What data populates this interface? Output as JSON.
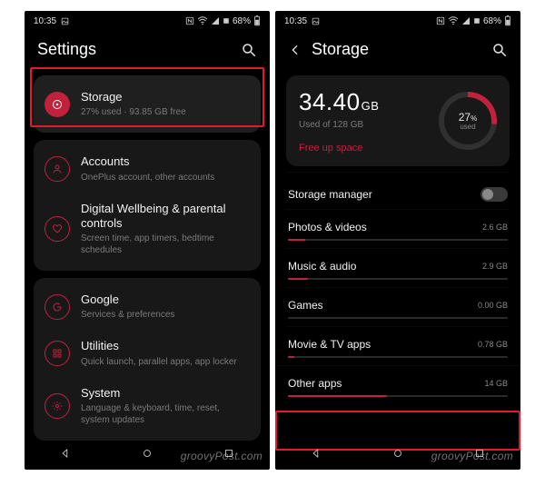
{
  "status": {
    "time": "10:35",
    "battery": "68%"
  },
  "left": {
    "title": "Settings",
    "items": [
      {
        "icon": "disc",
        "title": "Storage",
        "sub": "27% used · 93.85 GB free"
      },
      {
        "icon": "user",
        "title": "Accounts",
        "sub": "OnePlus account, other accounts"
      },
      {
        "icon": "heart",
        "title": "Digital Wellbeing & parental controls",
        "sub": "Screen time, app timers, bedtime schedules"
      },
      {
        "icon": "google",
        "title": "Google",
        "sub": "Services & preferences"
      },
      {
        "icon": "grid",
        "title": "Utilities",
        "sub": "Quick launch, parallel apps, app locker"
      },
      {
        "icon": "gear",
        "title": "System",
        "sub": "Language & keyboard, time, reset, system updates"
      }
    ]
  },
  "right": {
    "title": "Storage",
    "hero": {
      "value": "34.40",
      "unit": "GB",
      "sub": "Used of 128 GB",
      "link": "Free up space",
      "ring_percent": "27",
      "ring_suffix": "%",
      "ring_label": "used"
    },
    "manager_label": "Storage manager",
    "rows": [
      {
        "label": "Photos & videos",
        "value": "2.6 GB",
        "pct": 8
      },
      {
        "label": "Music & audio",
        "value": "2.9 GB",
        "pct": 9
      },
      {
        "label": "Games",
        "value": "0.00 GB",
        "pct": 0
      },
      {
        "label": "Movie & TV apps",
        "value": "0.78 GB",
        "pct": 3
      },
      {
        "label": "Other apps",
        "value": "14 GB",
        "pct": 45
      }
    ]
  },
  "watermark": "groovyPost.com"
}
